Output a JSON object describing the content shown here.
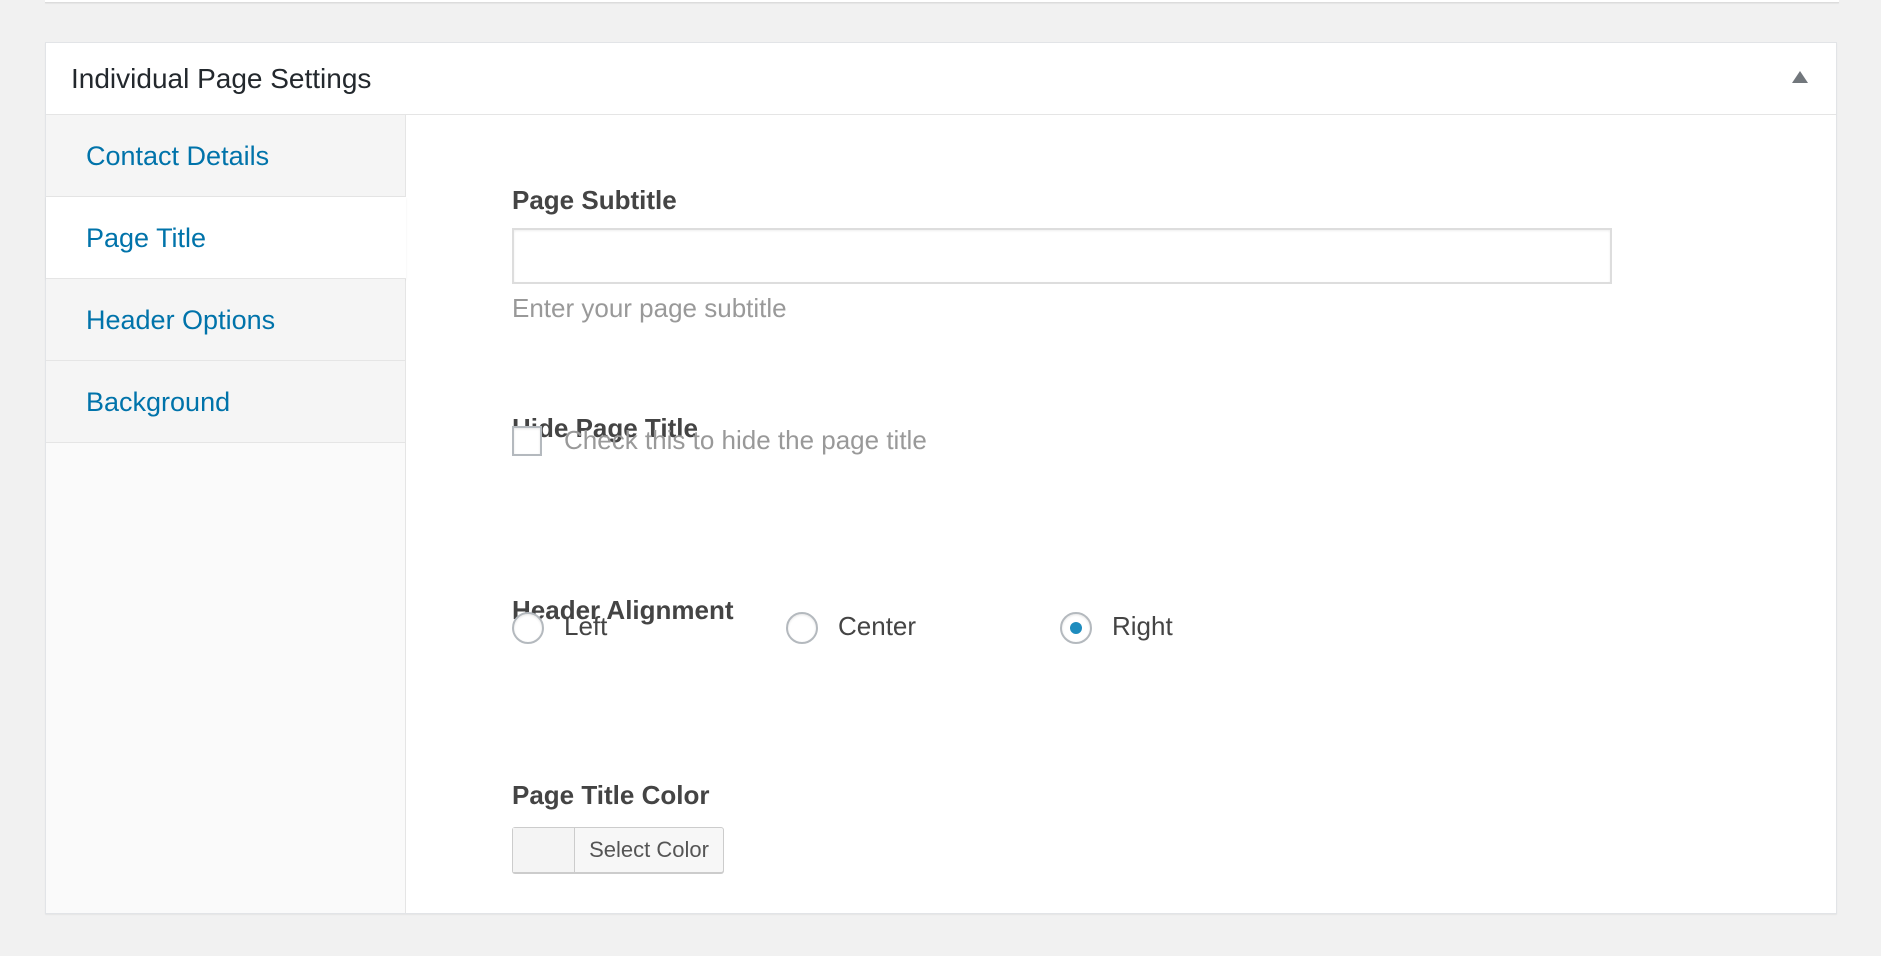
{
  "metabox": {
    "title": "Individual Page Settings"
  },
  "tabs": [
    {
      "label": "Contact Details",
      "active": false
    },
    {
      "label": "Page Title",
      "active": true
    },
    {
      "label": "Header Options",
      "active": false
    },
    {
      "label": "Background",
      "active": false
    }
  ],
  "fields": {
    "subtitle": {
      "label": "Page Subtitle",
      "value": "",
      "placeholder": "",
      "description": "Enter your page subtitle"
    },
    "hide_title": {
      "label": "Hide Page Title",
      "checkbox_label": "Check this to hide the page title",
      "checked": false
    },
    "header_alignment": {
      "label": "Header Alignment",
      "options": [
        "Left",
        "Center",
        "Right"
      ],
      "selected": "Right"
    },
    "title_color": {
      "label": "Page Title Color",
      "button_label": "Select Color"
    }
  },
  "colors": {
    "link": "#0073aa",
    "radio_checked": "#1e8cbe",
    "background": "#f1f1f1"
  }
}
